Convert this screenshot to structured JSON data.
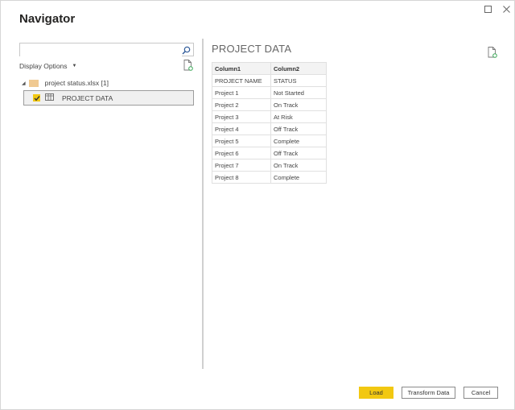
{
  "window": {
    "title": "Navigator",
    "maximize_icon": "maximize-icon",
    "close_icon": "close-icon"
  },
  "left_panel": {
    "search": {
      "value": "",
      "placeholder": "",
      "icon": "search-icon"
    },
    "display_options_label": "Display Options",
    "refresh_icon": "refresh-file-icon",
    "tree": {
      "file": {
        "label": "project status.xlsx [1]",
        "expanded": true,
        "icon": "folder-icon"
      },
      "items": [
        {
          "label": "PROJECT DATA",
          "checked": true,
          "selected": true,
          "icon": "table-icon"
        }
      ]
    }
  },
  "preview": {
    "title": "PROJECT DATA",
    "refresh_icon": "refresh-file-icon",
    "columns": [
      "Column1",
      "Column2"
    ],
    "rows": [
      [
        "PROJECT NAME",
        "STATUS"
      ],
      [
        "Project 1",
        "Not Started"
      ],
      [
        "Project 2",
        "On Track"
      ],
      [
        "Project 3",
        "At Risk"
      ],
      [
        "Project 4",
        "Off Track"
      ],
      [
        "Project 5",
        "Complete"
      ],
      [
        "Project 6",
        "Off Track"
      ],
      [
        "Project 7",
        "On Track"
      ],
      [
        "Project 8",
        "Complete"
      ]
    ]
  },
  "footer": {
    "load_label": "Load",
    "transform_label": "Transform Data",
    "cancel_label": "Cancel"
  },
  "colors": {
    "accent": "#f2c811",
    "folder": "#f0c991",
    "refresh_green": "#3aa857"
  }
}
